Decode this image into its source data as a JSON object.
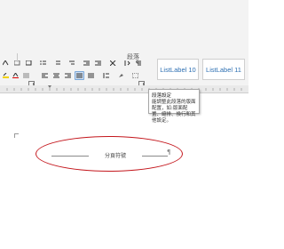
{
  "ribbon": {
    "group_label": "段落",
    "styles": [
      "ListLabel 10",
      "ListLabel 11"
    ]
  },
  "tooltip": {
    "title": "段落設定",
    "description": "能調整此段落的版面配置，如:版面配置、縮排、換行和其他設定。"
  },
  "document": {
    "divider_text": "分頁符號",
    "paragraph_mark": "¶"
  },
  "colors": {
    "highlight_ellipse": "#c4171d",
    "style_text": "#2d6fb2"
  }
}
